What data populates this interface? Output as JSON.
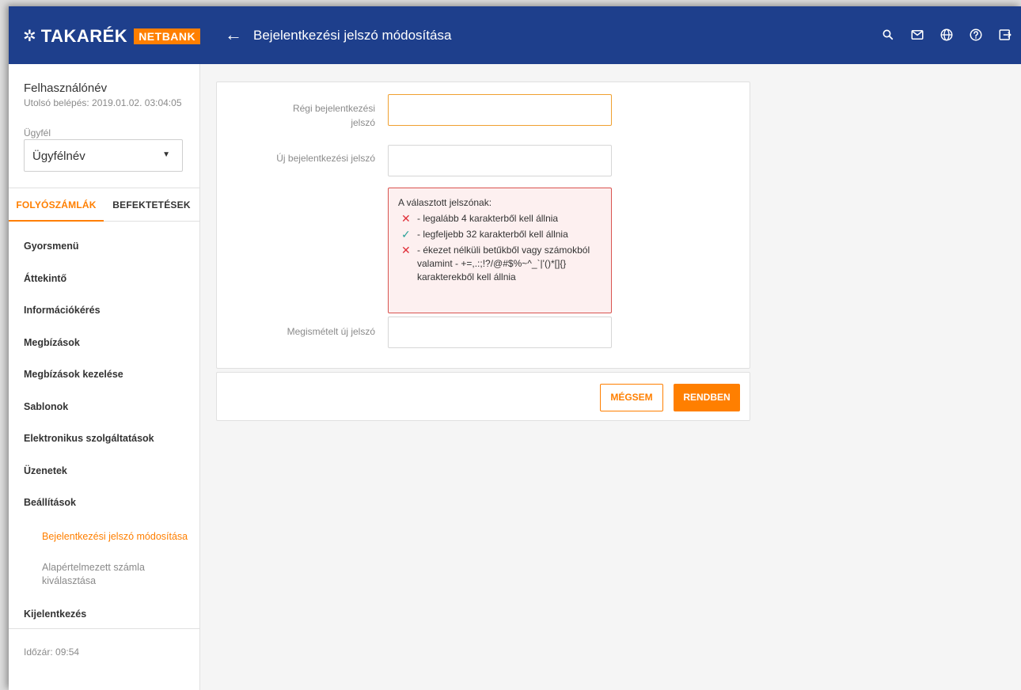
{
  "header": {
    "logo_text": "TAKARÉK",
    "logo_badge": "NETBANK",
    "title": "Bejelentkezési jelszó módosítása",
    "icons": [
      "search-icon",
      "mail-icon",
      "globe-icon",
      "help-icon",
      "logout-icon"
    ]
  },
  "sidebar": {
    "user_name": "Felhasználónév",
    "last_login": "Utolsó belépés: 2019.01.02. 03:04:05",
    "client_label": "Ügyfél",
    "client_value": "Ügyfélnév",
    "tabs": [
      "FOLYÓSZÁMLÁK",
      "BEFEKTETÉSEK"
    ],
    "items": [
      "Gyorsmenü",
      "Áttekintő",
      "Információkérés",
      "Megbízások",
      "Megbízások kezelése",
      "Sablonok",
      "Elektronikus szolgáltatások",
      "Üzenetek",
      "Beállítások"
    ],
    "subitems": [
      "Bejelentkezési jelszó módosítása",
      "Alapértelmezett számla kiválasztása"
    ],
    "logout": "Kijelentkezés",
    "timer": "Időzár: 09:54"
  },
  "form": {
    "old_password_label": "Régi bejelentkezési jelszó",
    "new_password_label": "Új bejelentkezési jelszó",
    "repeat_password_label": "Megismételt új jelszó",
    "rules_title": "A választott jelszónak:",
    "rules": [
      {
        "status": "fail",
        "text": "- legalább 4 karakterből kell állnia"
      },
      {
        "status": "pass",
        "text": "- legfeljebb 32 karakterből kell állnia"
      },
      {
        "status": "fail",
        "text": "- ékezet nélküli betűkből vagy számokból valamint - +=,.:;!?/@#$%~^_`|'()*[]{} karakterekből kell állnia"
      }
    ]
  },
  "buttons": {
    "cancel": "MÉGSEM",
    "ok": "RENDBEN"
  },
  "colors": {
    "header": "#1e3f8c",
    "accent": "#ff7f00",
    "error": "#e0303a",
    "success": "#2aa198"
  }
}
